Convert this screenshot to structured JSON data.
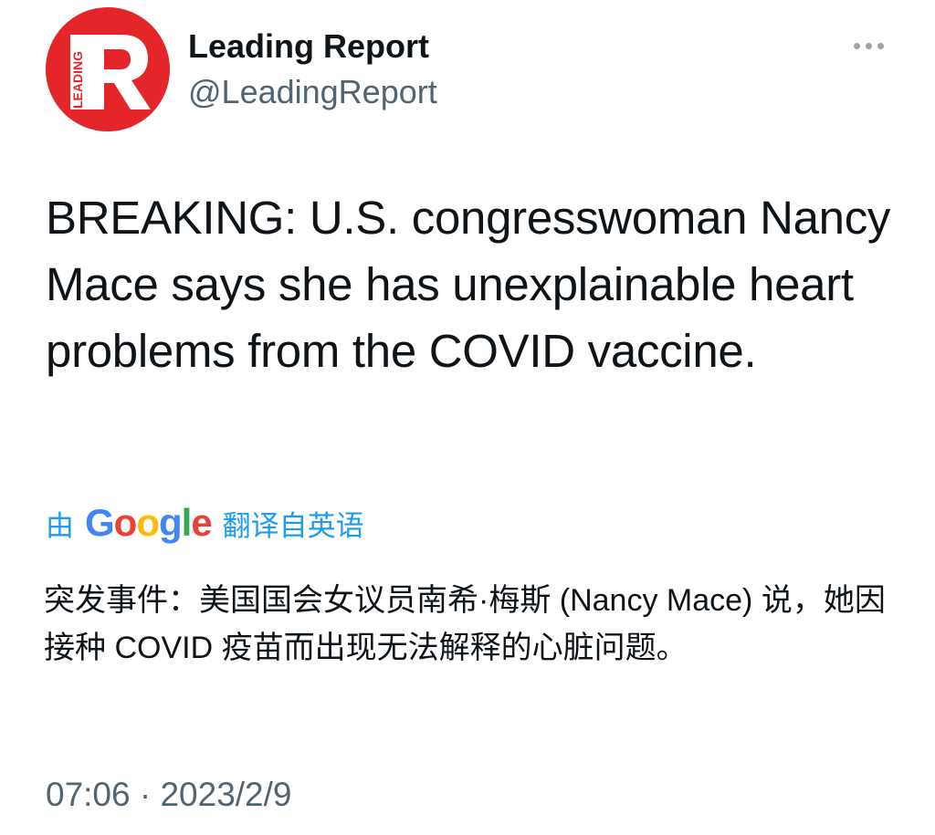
{
  "tweet": {
    "author": {
      "display_name": "Leading Report",
      "handle": "@LeadingReport",
      "avatar": {
        "icon": "leading-report-logo-icon",
        "letter": "R",
        "side_text": "LEADING",
        "background_color": "#e4262b"
      }
    },
    "more_icon": "more-options-icon",
    "text": "BREAKING: U.S. congresswoman Nancy Mace says she has unexplainable heart problems from the COVID vaccine.",
    "translation": {
      "by_label": "由",
      "provider": "Google",
      "from_label": "翻译自英语",
      "text": "突发事件：美国国会女议员南希·梅斯 (Nancy Mace) 说，她因接种 COVID 疫苗而出现无法解释的心脏问题。"
    },
    "timestamp": "07:06 · 2023/2/9"
  },
  "colors": {
    "link_blue": "#1d9bf0",
    "secondary_text": "#536471",
    "primary_text": "#0f1419",
    "google_blue": "#4285f4",
    "google_red": "#ea4335",
    "google_yellow": "#fbbc05",
    "google_green": "#34a853"
  }
}
